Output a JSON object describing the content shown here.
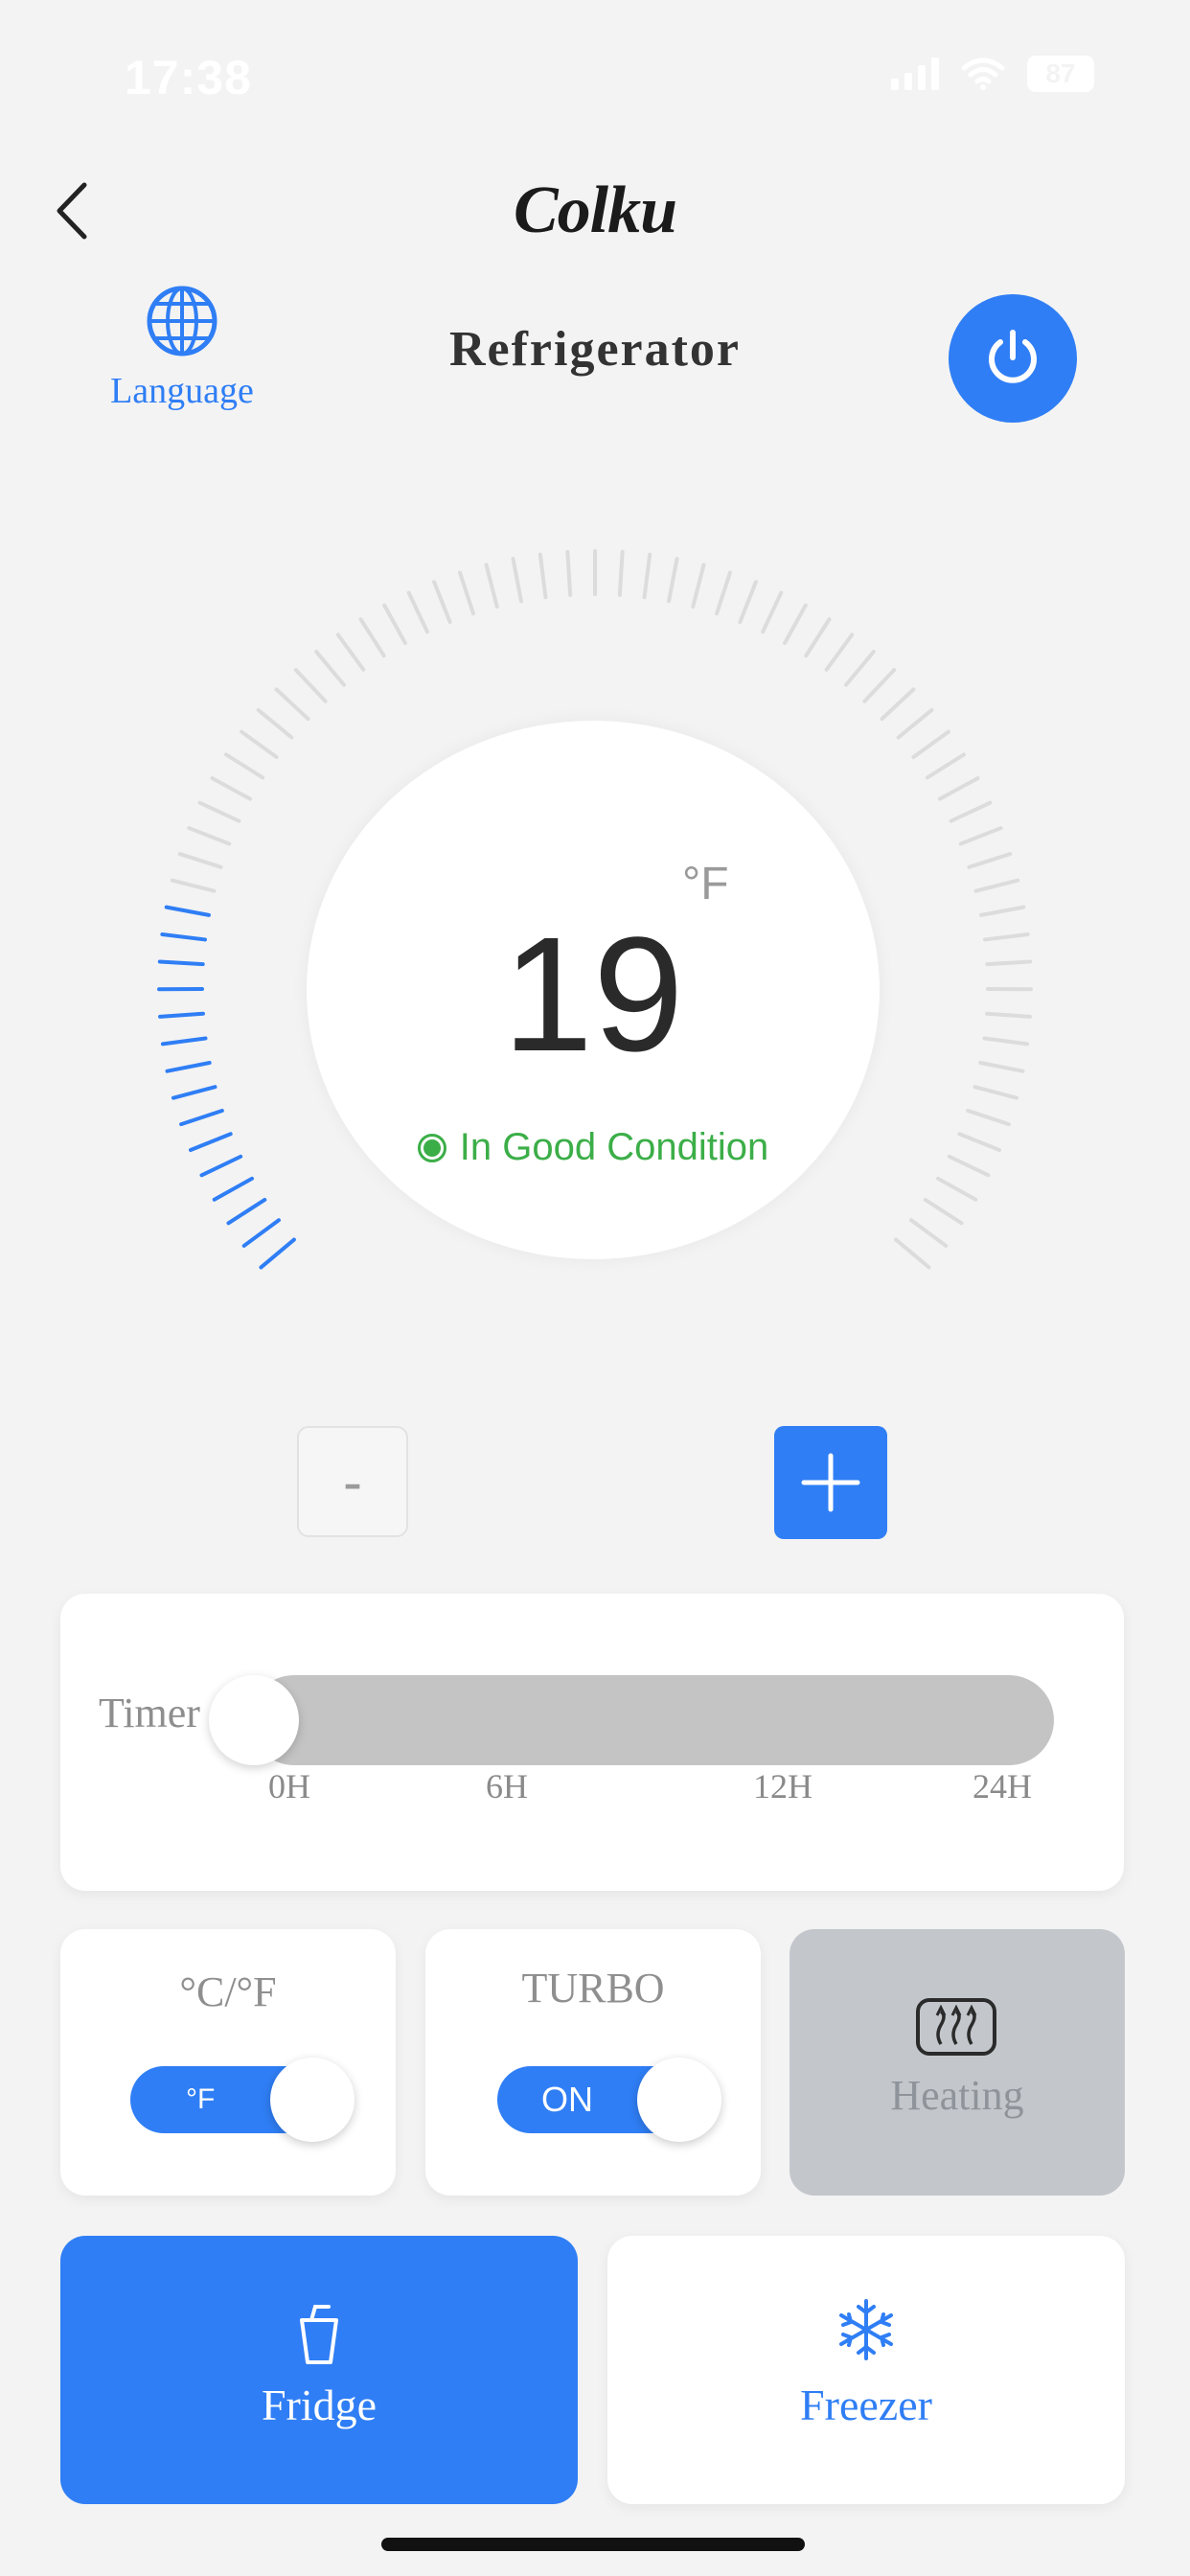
{
  "status_bar": {
    "time": "17:38",
    "battery": "87"
  },
  "header": {
    "brand": "Colku",
    "title": "Refrigerator",
    "language_label": "Language"
  },
  "dial": {
    "temperature": "19",
    "unit": "°F",
    "condition": "In Good Condition",
    "level_fraction": 0.2
  },
  "controls": {
    "minus_label": "-",
    "plus_label": "+"
  },
  "timer": {
    "label": "Timer",
    "ticks": [
      "0H",
      "6H",
      "12H",
      "24H"
    ],
    "value_hours": 0
  },
  "unit_card": {
    "title": "°C/°F",
    "toggle_text": "°F",
    "on": true
  },
  "turbo_card": {
    "title": "TURBO",
    "toggle_text": "ON",
    "on": true
  },
  "heating_card": {
    "label": "Heating"
  },
  "modes": {
    "fridge_label": "Fridge",
    "freezer_label": "Freezer",
    "selected": "Fridge"
  },
  "colors": {
    "accent": "#2f7ef5",
    "condition_green": "#3cae48",
    "inactive": "#c4c4c4"
  },
  "icons": [
    "chevron-left-icon",
    "globe-icon",
    "power-icon",
    "plus-icon",
    "heater-icon",
    "cup-icon",
    "snowflake-icon"
  ]
}
